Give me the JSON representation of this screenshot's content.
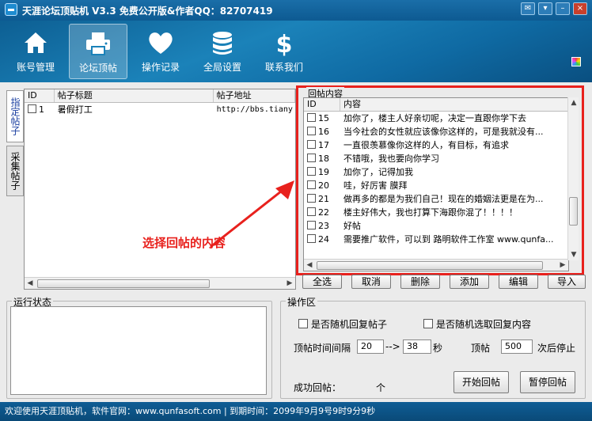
{
  "window": {
    "title": "天涯论坛顶贴机 V3.3 免费公开版&作者QQ：82707419"
  },
  "nav": {
    "items": [
      {
        "label": "账号管理"
      },
      {
        "label": "论坛顶帖"
      },
      {
        "label": "操作记录"
      },
      {
        "label": "全局设置"
      },
      {
        "label": "联系我们"
      }
    ]
  },
  "side_tabs": [
    {
      "label": "指定帖子"
    },
    {
      "label": "采集帖子"
    }
  ],
  "posts": {
    "columns": [
      "ID",
      "帖子标题",
      "帖子地址"
    ],
    "rows": [
      {
        "id": "1",
        "title": "暑假打工",
        "url": "http://bbs.tiany"
      }
    ]
  },
  "replies": {
    "legend": "回帖内容",
    "columns": [
      "ID",
      "内容"
    ],
    "rows": [
      {
        "id": "15",
        "text": "加你了，楼主人好亲切呢，决定一直跟你学下去"
      },
      {
        "id": "16",
        "text": "当今社会的女性就应该像你这样的，可是我就没有..."
      },
      {
        "id": "17",
        "text": "一直很羡慕像你这样的人，有目标，有追求"
      },
      {
        "id": "18",
        "text": "不错哦，我也要向你学习"
      },
      {
        "id": "19",
        "text": "加你了，记得加我"
      },
      {
        "id": "20",
        "text": "哇，好厉害 膜拜"
      },
      {
        "id": "21",
        "text": "做再多的都是为我们自己！现在的婚姻法更是在为..."
      },
      {
        "id": "22",
        "text": "楼主好伟大，我也打算下海跟你混了！！！！"
      },
      {
        "id": "23",
        "text": "好帖"
      },
      {
        "id": "24",
        "text": "需要推广软件，可以到 路明软件工作室 www.qunfa..."
      }
    ]
  },
  "annotation": "选择回帖的内容",
  "actions": [
    "全选",
    "取消",
    "删除",
    "添加",
    "编辑",
    "导入"
  ],
  "status_panel": {
    "legend": "运行状态"
  },
  "operations": {
    "legend": "操作区",
    "random_post_label": "是否随机回复帖子",
    "random_reply_label": "是否随机选取回复内容",
    "interval_label": "顶帖时间间隔",
    "interval_min": "20",
    "interval_arrow": "-->",
    "interval_max": "38",
    "interval_unit": "秒",
    "top_label": "顶帖",
    "top_count": "500",
    "stop_label": "次后停止",
    "success_label": "成功回帖：",
    "success_unit": "个",
    "start_button": "开始回帖",
    "pause_button": "暂停回帖"
  },
  "statusbar": {
    "text": "欢迎使用天涯顶贴机，软件官网：www.qunfasoft.com  | 到期时间：2099年9月9号9时9分9秒"
  },
  "colors": {
    "accent_red": "#e8211d",
    "nav_blue": "#1b82b9"
  }
}
